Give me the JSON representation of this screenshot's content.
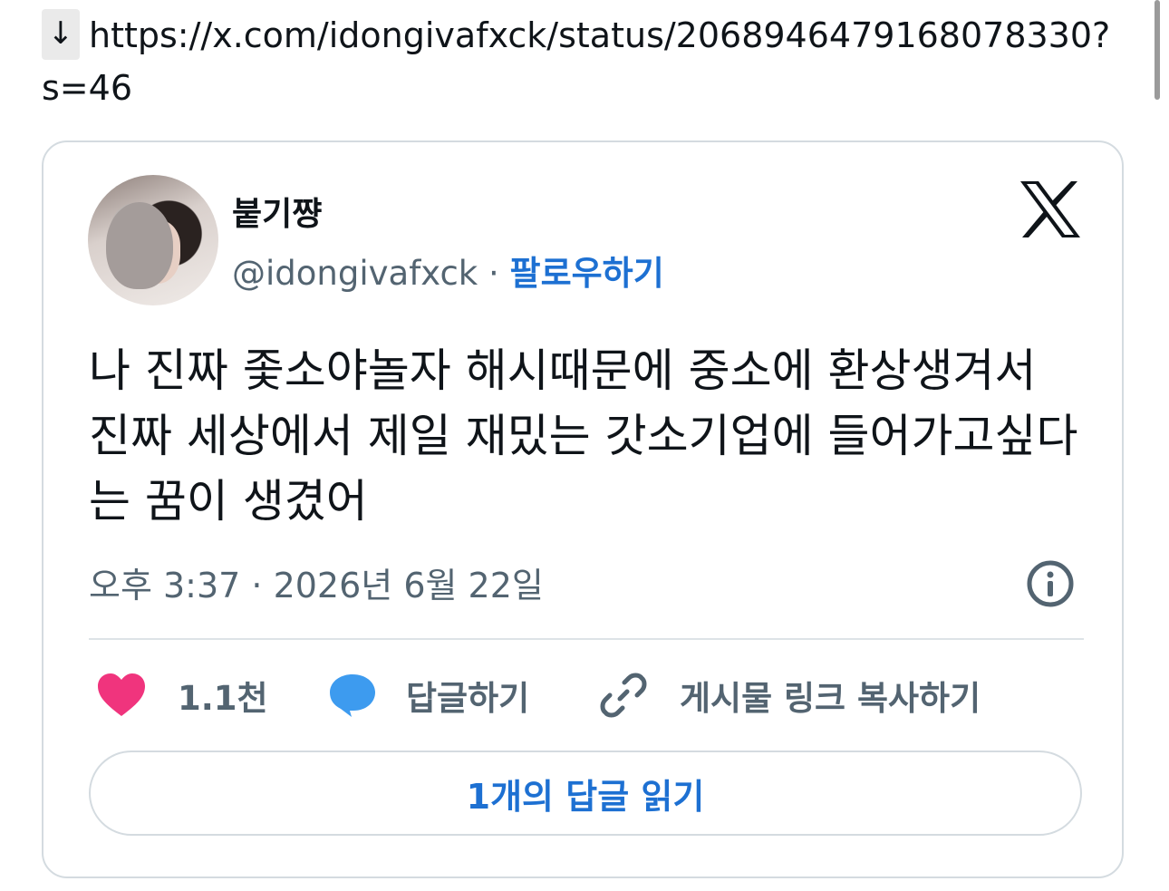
{
  "link": {
    "arrow": "↓",
    "url": "https://x.com/idongivafxck/status/2068946479168078330?s=46"
  },
  "tweet": {
    "display_name": "붙기쨩",
    "handle": "@idongivafxck",
    "separator": "·",
    "follow_label": "팔로우하기",
    "text": "나 진짜 좇소야놀자 해시때문에 중소에 환상생겨서 진짜 세상에서 제일 재밌는 갓소기업에 들어가고싶다는 꿈이 생겼어",
    "timestamp": "오후 3:37 · 2026년 6월 22일",
    "like_count": "1.1천",
    "reply_label": "답글하기",
    "copy_link_label": "게시물 링크 복사하기",
    "read_replies_label": "1개의 답글 읽기"
  },
  "icons": {
    "x_logo": "x-logo-icon",
    "info": "info-icon",
    "heart": "heart-icon",
    "reply": "speech-bubble-icon",
    "link": "link-icon"
  },
  "colors": {
    "accent": "#1d70d2",
    "heart": "#f0347d",
    "reply_bubble": "#3d9bef",
    "muted_text": "#536471",
    "border": "#d4dbe0"
  }
}
